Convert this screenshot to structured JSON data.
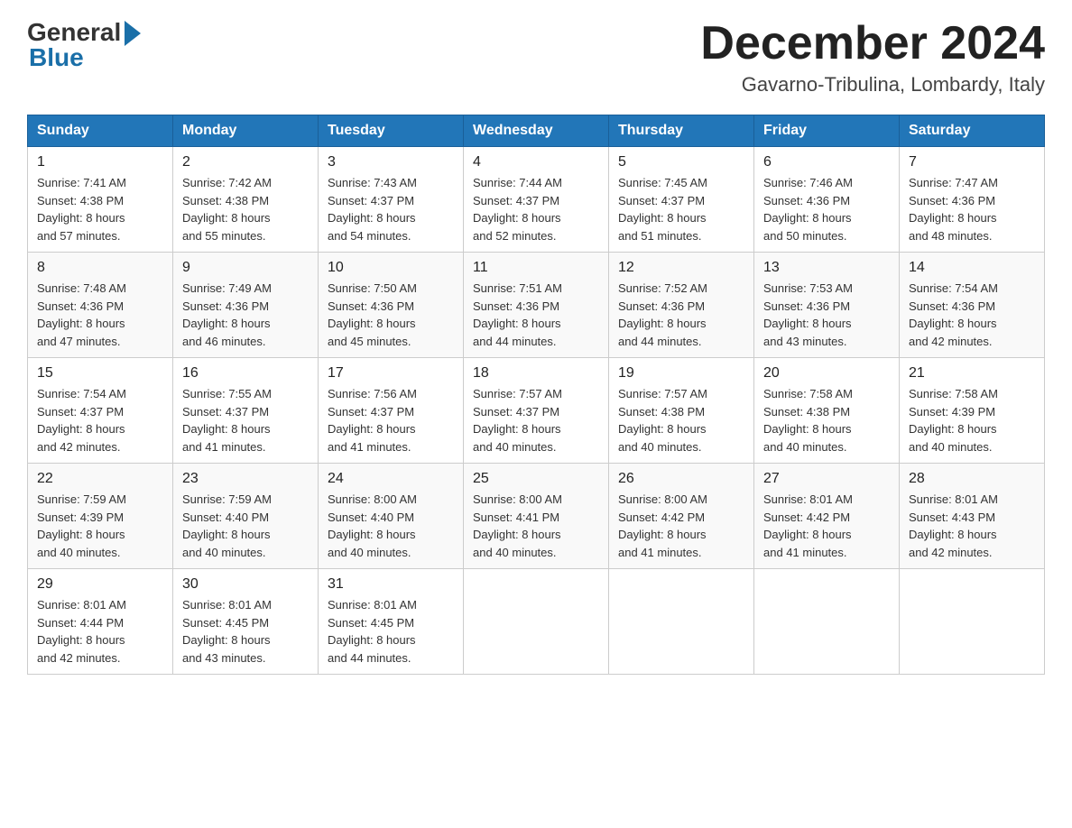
{
  "header": {
    "logo_general": "General",
    "logo_blue": "Blue",
    "month_title": "December 2024",
    "location": "Gavarno-Tribulina, Lombardy, Italy"
  },
  "days_of_week": [
    "Sunday",
    "Monday",
    "Tuesday",
    "Wednesday",
    "Thursday",
    "Friday",
    "Saturday"
  ],
  "weeks": [
    [
      {
        "day": "1",
        "sunrise": "7:41 AM",
        "sunset": "4:38 PM",
        "daylight": "8 hours and 57 minutes."
      },
      {
        "day": "2",
        "sunrise": "7:42 AM",
        "sunset": "4:38 PM",
        "daylight": "8 hours and 55 minutes."
      },
      {
        "day": "3",
        "sunrise": "7:43 AM",
        "sunset": "4:37 PM",
        "daylight": "8 hours and 54 minutes."
      },
      {
        "day": "4",
        "sunrise": "7:44 AM",
        "sunset": "4:37 PM",
        "daylight": "8 hours and 52 minutes."
      },
      {
        "day": "5",
        "sunrise": "7:45 AM",
        "sunset": "4:37 PM",
        "daylight": "8 hours and 51 minutes."
      },
      {
        "day": "6",
        "sunrise": "7:46 AM",
        "sunset": "4:36 PM",
        "daylight": "8 hours and 50 minutes."
      },
      {
        "day": "7",
        "sunrise": "7:47 AM",
        "sunset": "4:36 PM",
        "daylight": "8 hours and 48 minutes."
      }
    ],
    [
      {
        "day": "8",
        "sunrise": "7:48 AM",
        "sunset": "4:36 PM",
        "daylight": "8 hours and 47 minutes."
      },
      {
        "day": "9",
        "sunrise": "7:49 AM",
        "sunset": "4:36 PM",
        "daylight": "8 hours and 46 minutes."
      },
      {
        "day": "10",
        "sunrise": "7:50 AM",
        "sunset": "4:36 PM",
        "daylight": "8 hours and 45 minutes."
      },
      {
        "day": "11",
        "sunrise": "7:51 AM",
        "sunset": "4:36 PM",
        "daylight": "8 hours and 44 minutes."
      },
      {
        "day": "12",
        "sunrise": "7:52 AM",
        "sunset": "4:36 PM",
        "daylight": "8 hours and 44 minutes."
      },
      {
        "day": "13",
        "sunrise": "7:53 AM",
        "sunset": "4:36 PM",
        "daylight": "8 hours and 43 minutes."
      },
      {
        "day": "14",
        "sunrise": "7:54 AM",
        "sunset": "4:36 PM",
        "daylight": "8 hours and 42 minutes."
      }
    ],
    [
      {
        "day": "15",
        "sunrise": "7:54 AM",
        "sunset": "4:37 PM",
        "daylight": "8 hours and 42 minutes."
      },
      {
        "day": "16",
        "sunrise": "7:55 AM",
        "sunset": "4:37 PM",
        "daylight": "8 hours and 41 minutes."
      },
      {
        "day": "17",
        "sunrise": "7:56 AM",
        "sunset": "4:37 PM",
        "daylight": "8 hours and 41 minutes."
      },
      {
        "day": "18",
        "sunrise": "7:57 AM",
        "sunset": "4:37 PM",
        "daylight": "8 hours and 40 minutes."
      },
      {
        "day": "19",
        "sunrise": "7:57 AM",
        "sunset": "4:38 PM",
        "daylight": "8 hours and 40 minutes."
      },
      {
        "day": "20",
        "sunrise": "7:58 AM",
        "sunset": "4:38 PM",
        "daylight": "8 hours and 40 minutes."
      },
      {
        "day": "21",
        "sunrise": "7:58 AM",
        "sunset": "4:39 PM",
        "daylight": "8 hours and 40 minutes."
      }
    ],
    [
      {
        "day": "22",
        "sunrise": "7:59 AM",
        "sunset": "4:39 PM",
        "daylight": "8 hours and 40 minutes."
      },
      {
        "day": "23",
        "sunrise": "7:59 AM",
        "sunset": "4:40 PM",
        "daylight": "8 hours and 40 minutes."
      },
      {
        "day": "24",
        "sunrise": "8:00 AM",
        "sunset": "4:40 PM",
        "daylight": "8 hours and 40 minutes."
      },
      {
        "day": "25",
        "sunrise": "8:00 AM",
        "sunset": "4:41 PM",
        "daylight": "8 hours and 40 minutes."
      },
      {
        "day": "26",
        "sunrise": "8:00 AM",
        "sunset": "4:42 PM",
        "daylight": "8 hours and 41 minutes."
      },
      {
        "day": "27",
        "sunrise": "8:01 AM",
        "sunset": "4:42 PM",
        "daylight": "8 hours and 41 minutes."
      },
      {
        "day": "28",
        "sunrise": "8:01 AM",
        "sunset": "4:43 PM",
        "daylight": "8 hours and 42 minutes."
      }
    ],
    [
      {
        "day": "29",
        "sunrise": "8:01 AM",
        "sunset": "4:44 PM",
        "daylight": "8 hours and 42 minutes."
      },
      {
        "day": "30",
        "sunrise": "8:01 AM",
        "sunset": "4:45 PM",
        "daylight": "8 hours and 43 minutes."
      },
      {
        "day": "31",
        "sunrise": "8:01 AM",
        "sunset": "4:45 PM",
        "daylight": "8 hours and 44 minutes."
      },
      null,
      null,
      null,
      null
    ]
  ],
  "labels": {
    "sunrise": "Sunrise:",
    "sunset": "Sunset:",
    "daylight": "Daylight:"
  }
}
